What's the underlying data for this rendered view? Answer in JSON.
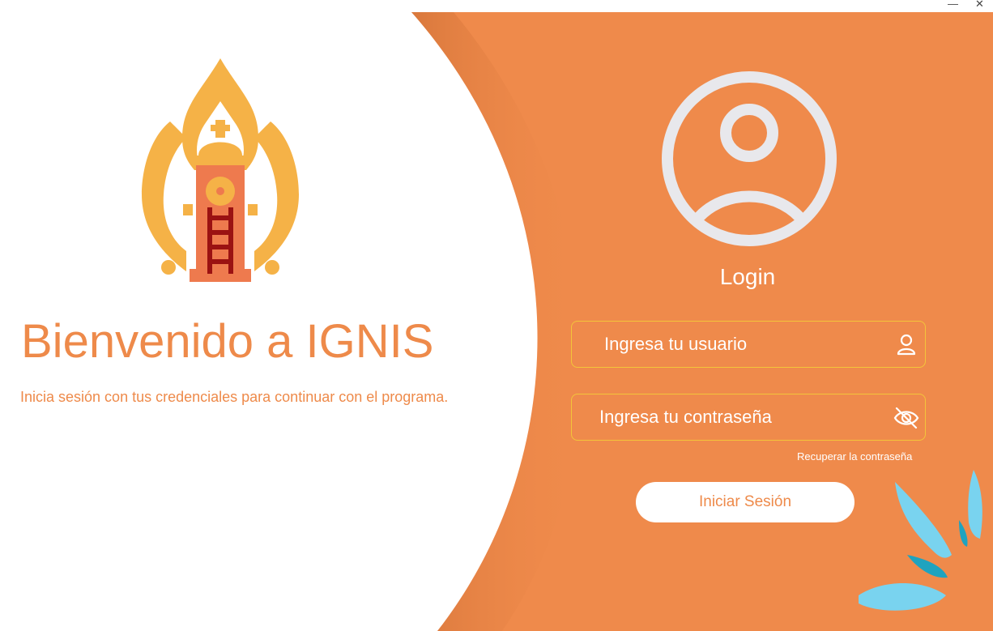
{
  "window": {
    "minimize_glyph": "—",
    "close_glyph": "✕"
  },
  "welcome": {
    "title": "Bienvenido a IGNIS",
    "subtitle": "Inicia sesión con tus credenciales para continuar con el programa."
  },
  "login": {
    "title": "Login",
    "username_placeholder": "Ingresa tu usuario",
    "password_placeholder": "Ingresa tu contraseña",
    "recover_label": "Recuperar la contraseña",
    "submit_label": "Iniciar Sesión"
  },
  "colors": {
    "accent_orange": "#ef8a4b",
    "field_border": "#f3c53a",
    "avatar_gray": "#e8e8ec",
    "splash_blue": "#79d3ef"
  },
  "icons": {
    "logo": "fire-tower-logo",
    "avatar": "user-avatar-icon",
    "username": "user-icon",
    "password": "eye-slash-icon"
  }
}
